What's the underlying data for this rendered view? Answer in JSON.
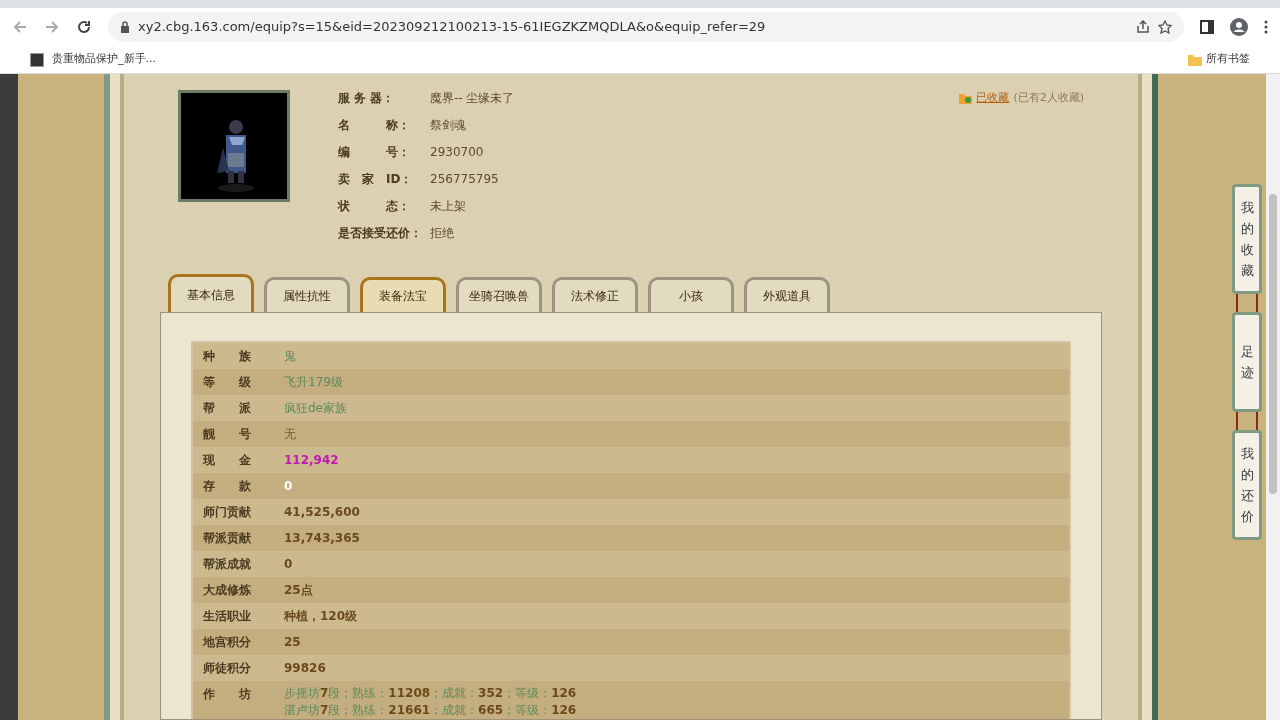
{
  "browser": {
    "url": "xy2.cbg.163.com/equip?s=15&eid=202309212100213-15-61IEGZKZMQDLA&o&equip_refer=29",
    "bookmarks": [
      {
        "label": "贵重物品保护_新手..."
      }
    ],
    "all_bookmarks": "所有书签"
  },
  "summary": {
    "fields": [
      {
        "label": "服 务 器：",
        "value": "魔界-- 尘缘未了"
      },
      {
        "label": "名　　　称：",
        "value": "祭剑魂"
      },
      {
        "label": "编　　　号：",
        "value": "2930700"
      },
      {
        "label": "卖　家　ID：",
        "value": "256775795"
      },
      {
        "label": "状　　　态：",
        "value": "未上架"
      },
      {
        "label": "是否接受还价：",
        "value": "拒绝"
      }
    ],
    "favorite": {
      "link": "已收藏",
      "count": "(已有2人收藏)"
    }
  },
  "tabs": [
    {
      "label": "基本信息",
      "selected": true,
      "hovered": false
    },
    {
      "label": "属性抗性",
      "selected": false,
      "hovered": false
    },
    {
      "label": "装备法宝",
      "selected": false,
      "hovered": true
    },
    {
      "label": "坐骑召唤兽",
      "selected": false,
      "hovered": false
    },
    {
      "label": "法术修正",
      "selected": false,
      "hovered": false
    },
    {
      "label": "小孩",
      "selected": false,
      "hovered": false
    },
    {
      "label": "外观道具",
      "selected": false,
      "hovered": false
    }
  ],
  "info_rows": [
    {
      "label": "种　　族",
      "value": "鬼",
      "kind": "link"
    },
    {
      "label": "等　　级",
      "value": "飞升179级",
      "kind": "link"
    },
    {
      "label": "帮　　派",
      "value": "疯狂de家族",
      "kind": "link"
    },
    {
      "label": "靓　　号",
      "value": "无",
      "kind": "plain"
    },
    {
      "label": "现　　金",
      "value": "112,942",
      "kind": "money"
    },
    {
      "label": "存　　款",
      "value": "0",
      "kind": "deposit"
    },
    {
      "label": "师门贡献",
      "value": "41,525,600",
      "kind": "number"
    },
    {
      "label": "帮派贡献",
      "value": "13,743,365",
      "kind": "number"
    },
    {
      "label": "帮派成就",
      "value": "0",
      "kind": "number"
    },
    {
      "label": "大成修炼",
      "value": "25点",
      "kind": "number"
    },
    {
      "label": "生活职业",
      "value": "种植，120级",
      "kind": "number"
    },
    {
      "label": "地宫积分",
      "value": "25",
      "kind": "number"
    },
    {
      "label": "师徒积分",
      "value": "99826",
      "kind": "number"
    }
  ],
  "workshop": {
    "label": "作　　坊",
    "lines": [
      [
        {
          "text": "步摇坊",
          "kind": "label"
        },
        {
          "text": "7",
          "kind": "value"
        },
        {
          "text": "段；熟练：",
          "kind": "label"
        },
        {
          "text": "11208",
          "kind": "value"
        },
        {
          "text": "；成就：",
          "kind": "label"
        },
        {
          "text": "352",
          "kind": "value"
        },
        {
          "text": "；等级：",
          "kind": "label"
        },
        {
          "text": "126",
          "kind": "value"
        }
      ],
      [
        {
          "text": "湛卢坊",
          "kind": "label"
        },
        {
          "text": "7",
          "kind": "value"
        },
        {
          "text": "段；熟练：",
          "kind": "label"
        },
        {
          "text": "21661",
          "kind": "value"
        },
        {
          "text": "；成就：",
          "kind": "label"
        },
        {
          "text": "665",
          "kind": "value"
        },
        {
          "text": "；等级：",
          "kind": "label"
        },
        {
          "text": "126",
          "kind": "value"
        }
      ]
    ]
  },
  "side_buttons": [
    {
      "label": "我的收藏"
    },
    {
      "label": "足迹"
    },
    {
      "label": "我的还价"
    }
  ]
}
